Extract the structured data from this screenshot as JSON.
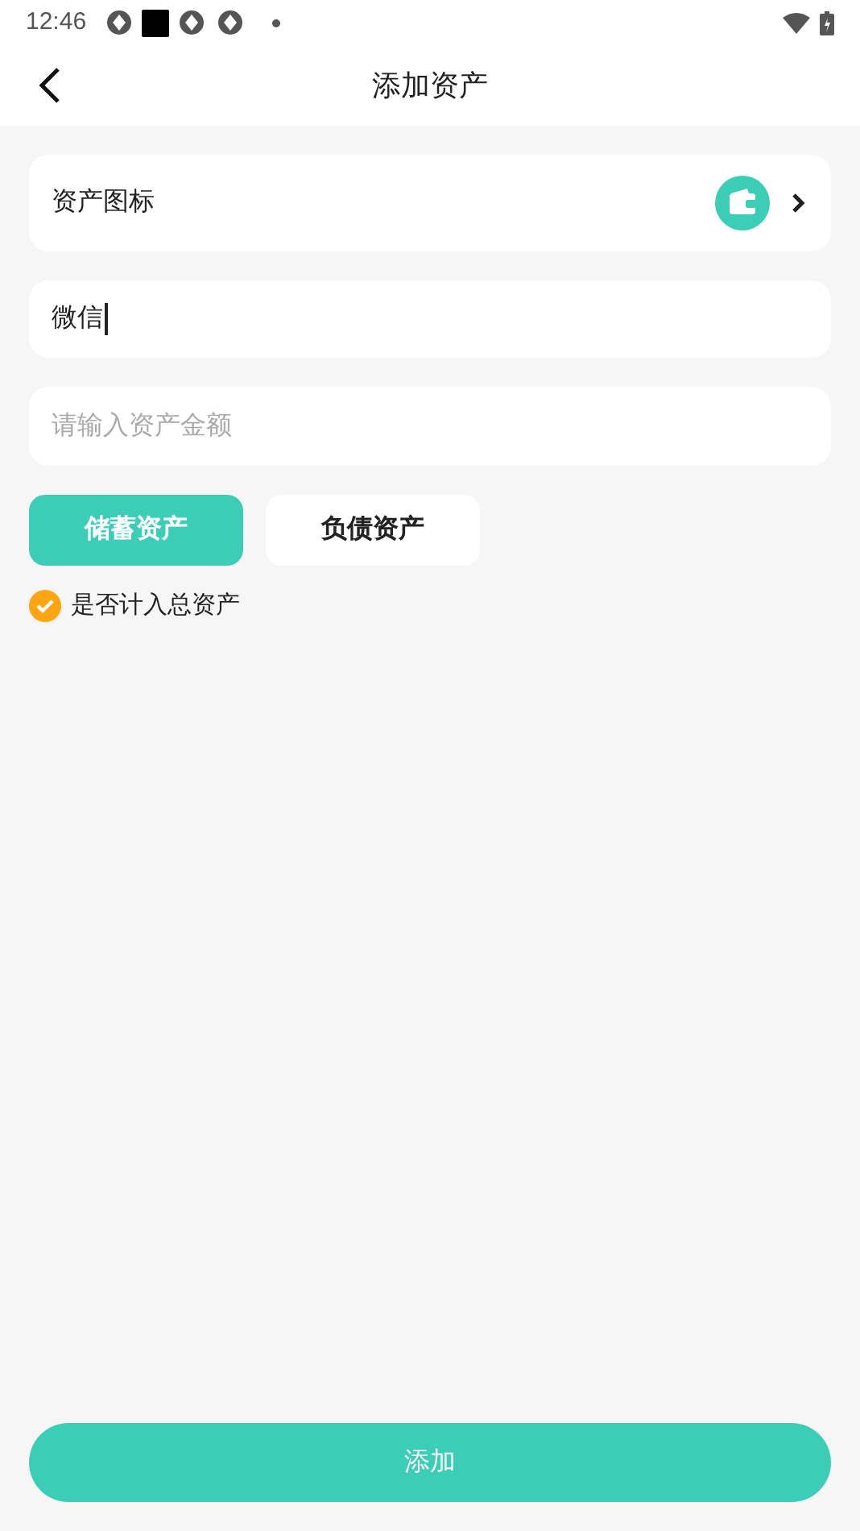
{
  "status_bar": {
    "time": "12:46"
  },
  "header": {
    "title": "添加资产"
  },
  "icon_row": {
    "label": "资产图标"
  },
  "name_field": {
    "value": "微信",
    "focused": true
  },
  "amount_field": {
    "placeholder": "请输入资产金额"
  },
  "types": [
    {
      "label": "储蓄资产",
      "selected": true
    },
    {
      "label": "负债资产",
      "selected": false
    }
  ],
  "include_total": {
    "label": "是否计入总资产",
    "checked": true
  },
  "submit": {
    "label": "添加"
  }
}
